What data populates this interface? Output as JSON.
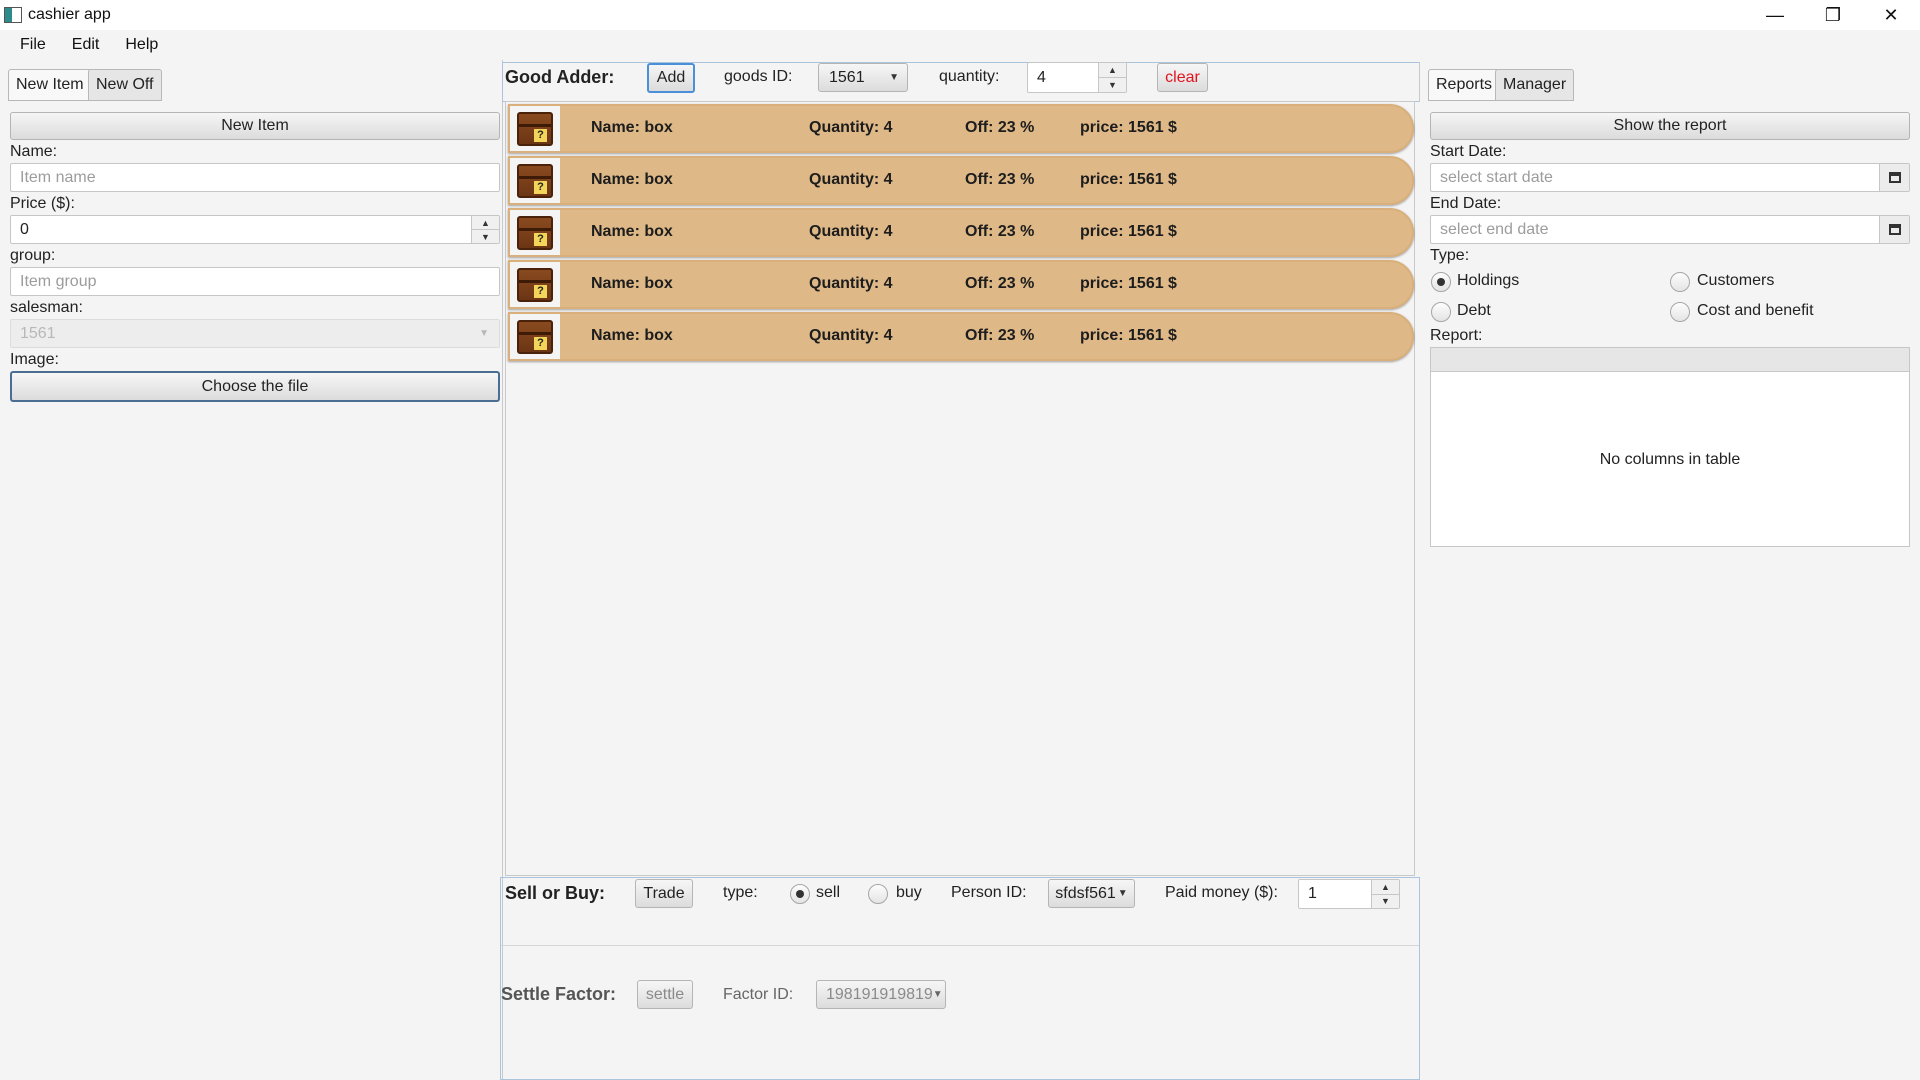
{
  "window": {
    "title": "cashier app",
    "minimize": "—",
    "maximize": "❐",
    "close": "✕"
  },
  "menu": [
    "File",
    "Edit",
    "Help"
  ],
  "left": {
    "tabs": [
      "New Item",
      "New Off"
    ],
    "new_item_button": "New Item",
    "name_label": "Name:",
    "name_placeholder": "Item name",
    "price_label": "Price ($):",
    "price_value": "0",
    "group_label": "group:",
    "group_placeholder": "Item group",
    "salesman_label": "salesman:",
    "salesman_value": "1561",
    "image_label": "Image:",
    "choose_file_button": "Choose the file"
  },
  "good_adder": {
    "title": "Good Adder:",
    "add_button": "Add",
    "goods_id_label": "goods ID:",
    "goods_id_value": "1561",
    "quantity_label": "quantity:",
    "quantity_value": "4",
    "clear_button": "clear"
  },
  "goods": [
    {
      "name": "Name: box",
      "quantity": "Quantity: 4",
      "off": "Off: 23 %",
      "price": "price: 1561 $"
    },
    {
      "name": "Name: box",
      "quantity": "Quantity: 4",
      "off": "Off: 23 %",
      "price": "price: 1561 $"
    },
    {
      "name": "Name: box",
      "quantity": "Quantity: 4",
      "off": "Off: 23 %",
      "price": "price: 1561 $"
    },
    {
      "name": "Name: box",
      "quantity": "Quantity: 4",
      "off": "Off: 23 %",
      "price": "price: 1561 $"
    },
    {
      "name": "Name: box",
      "quantity": "Quantity: 4",
      "off": "Off: 23 %",
      "price": "price: 1561 $"
    }
  ],
  "goods_icon": "mystery-crate-icon",
  "sell_or_buy": {
    "title": "Sell or Buy:",
    "trade_button": "Trade",
    "type_label": "type:",
    "sell_label": "sell",
    "buy_label": "buy",
    "selected_type": "sell",
    "person_id_label": "Person ID:",
    "person_id_value": "sfdsf561",
    "paid_label": "Paid money ($):",
    "paid_value": "1"
  },
  "settle": {
    "title": "Settle Factor:",
    "settle_button": "settle",
    "factor_id_label": "Factor ID:",
    "factor_id_value": "198191919819"
  },
  "right": {
    "tabs": [
      "Reports",
      "Manager"
    ],
    "show_report_button": "Show the report",
    "start_label": "Start Date:",
    "start_placeholder": "select start date",
    "end_label": "End Date:",
    "end_placeholder": "select end date",
    "type_label": "Type:",
    "types": [
      "Holdings",
      "Customers",
      "Debt",
      "Cost and benefit"
    ],
    "selected_type": "Holdings",
    "report_label": "Report:",
    "table_empty": "No columns in table"
  },
  "colors": {
    "row_fill": "#deb887",
    "clear_text": "#e0141e",
    "focus_border": "#4a90d9"
  }
}
